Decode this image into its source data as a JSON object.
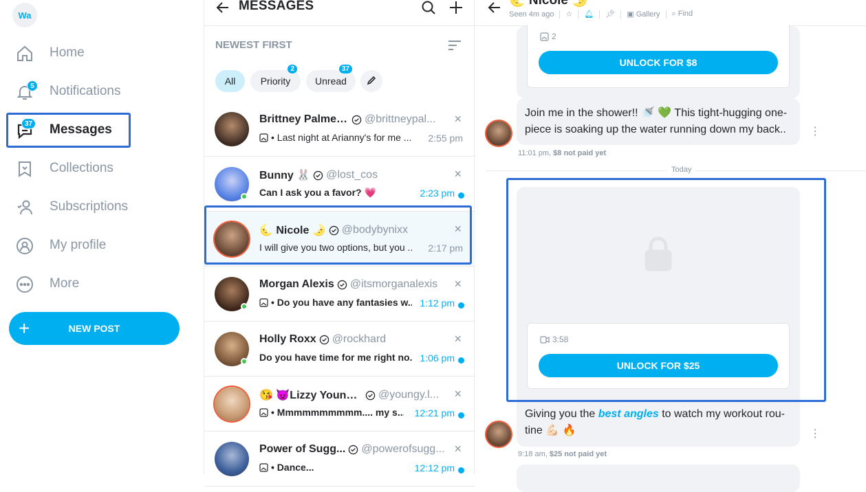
{
  "nav": {
    "avatar_initials": "Wa",
    "items": [
      {
        "label": "Home",
        "icon": "home-icon"
      },
      {
        "label": "Notifications",
        "icon": "bell-icon",
        "badge": "5"
      },
      {
        "label": "Messages",
        "icon": "chat-icon",
        "badge": "37",
        "active": true
      },
      {
        "label": "Collections",
        "icon": "collections-icon"
      },
      {
        "label": "Subscriptions",
        "icon": "subscriptions-icon"
      },
      {
        "label": "My profile",
        "icon": "profile-icon"
      },
      {
        "label": "More",
        "icon": "more-icon"
      }
    ],
    "new_post_label": "NEW POST"
  },
  "messages": {
    "title": "MESSAGES",
    "sort_label": "NEWEST FIRST",
    "filters": [
      {
        "label": "All",
        "active": true
      },
      {
        "label": "Priority",
        "badge": "2"
      },
      {
        "label": "Unread",
        "badge": "37"
      }
    ],
    "chats": [
      {
        "name": "Brittney Palmer ...",
        "handle": "@brittneypal...",
        "preview": "• Last night at Arianny's for me ...",
        "time": "2:55 pm",
        "has_image": true,
        "unread": false,
        "online": false,
        "story": false
      },
      {
        "name": "Bunny 🐰",
        "handle": "@lost_cos",
        "preview": "Can I ask you a favor? 💗",
        "time": "2:23 pm",
        "has_image": false,
        "unread": true,
        "online": true,
        "story": false
      },
      {
        "name": "🌜 Nicole 🌛",
        "handle": "@bodybynixx",
        "preview": "I will give you two options, but you ...",
        "time": "2:17 pm",
        "has_image": false,
        "unread": false,
        "online": false,
        "story": true,
        "selected": true
      },
      {
        "name": "Morgan Alexis",
        "handle": "@itsmorganalexis",
        "preview": "• Do you have any fantasies w...",
        "time": "1:12 pm",
        "has_image": true,
        "unread": true,
        "online": true,
        "story": false
      },
      {
        "name": "Holly Roxx",
        "handle": "@rockhard",
        "preview": "Do you have time for me right no...",
        "time": "1:06 pm",
        "has_image": false,
        "unread": true,
        "online": true,
        "story": false
      },
      {
        "name": "😘 👿Lizzy Youngy...",
        "handle": "@youngy.l...",
        "preview": "• Mmmmmmmmmm.... my s...",
        "time": "12:21 pm",
        "has_image": true,
        "unread": true,
        "online": false,
        "story": true
      },
      {
        "name": "Power of Sugg...",
        "handle": "@powerofsugg...",
        "preview": "• Dance...",
        "time": "12:12 pm",
        "has_image": true,
        "unread": true,
        "online": false,
        "story": false
      }
    ]
  },
  "conversation": {
    "name": "🌜 Nicole 🌛",
    "seen": "Seen 4m ago",
    "gallery_label": "Gallery",
    "find_label": "Find",
    "top_media_count": "2",
    "unlock_top": "UNLOCK FOR $8",
    "msg1_text": "Join me in the shower!! 🚿 💚 This tight-hugging one-piece is soaking up the water running down my back..",
    "msg1_time": "11:01 pm,",
    "msg1_status": "$8 not paid yet",
    "divider": "Today",
    "video_duration": "3:58",
    "unlock_video": "UNLOCK FOR $25",
    "msg2_pre": "Giving you the ",
    "msg2_accent": "best angles",
    "msg2_post": " to watch my workout rou-tine 💪🏻 🔥",
    "msg2_time": "9:18 am,",
    "msg2_status": "$25 not paid yet"
  },
  "colors": {
    "accent": "#00aff0",
    "highlight": "#2d6bd6",
    "story_ring": "#f05a36",
    "online": "#3fc84d"
  }
}
